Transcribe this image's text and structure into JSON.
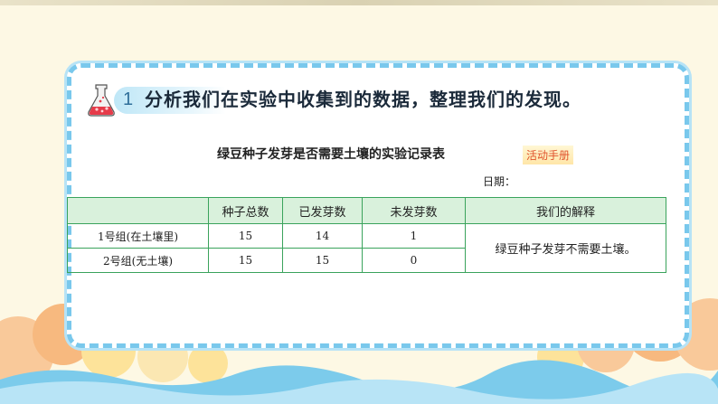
{
  "step": {
    "number": "1",
    "text": "分析我们在实验中收集到的数据，整理我们的发现。"
  },
  "table_title": "绿豆种子发芽是否需要土壤的实验记录表",
  "tag_label": "活动手册",
  "date_label": "日期：",
  "table": {
    "headers": [
      "",
      "种子总数",
      "已发芽数",
      "未发芽数",
      "我们的解释"
    ],
    "rows": [
      {
        "group": "1号组(在土壤里)",
        "total": "15",
        "sprouted": "14",
        "not_sprouted": "1"
      },
      {
        "group": "2号组(无土壤)",
        "total": "15",
        "sprouted": "15",
        "not_sprouted": "0"
      }
    ],
    "conclusion": "绿豆种子发芽不需要土壤。"
  },
  "colors": {
    "card_border": "#79c8ec",
    "table_border": "#3aa35c",
    "header_fill": "#d9f1dc",
    "tag_text": "#e0522c",
    "cloud_orange": "#f7b97f",
    "cloud_yellow": "#fde39a",
    "wave_blue": "#7ccbeb"
  },
  "icons": {
    "beaker": "flask-icon"
  }
}
